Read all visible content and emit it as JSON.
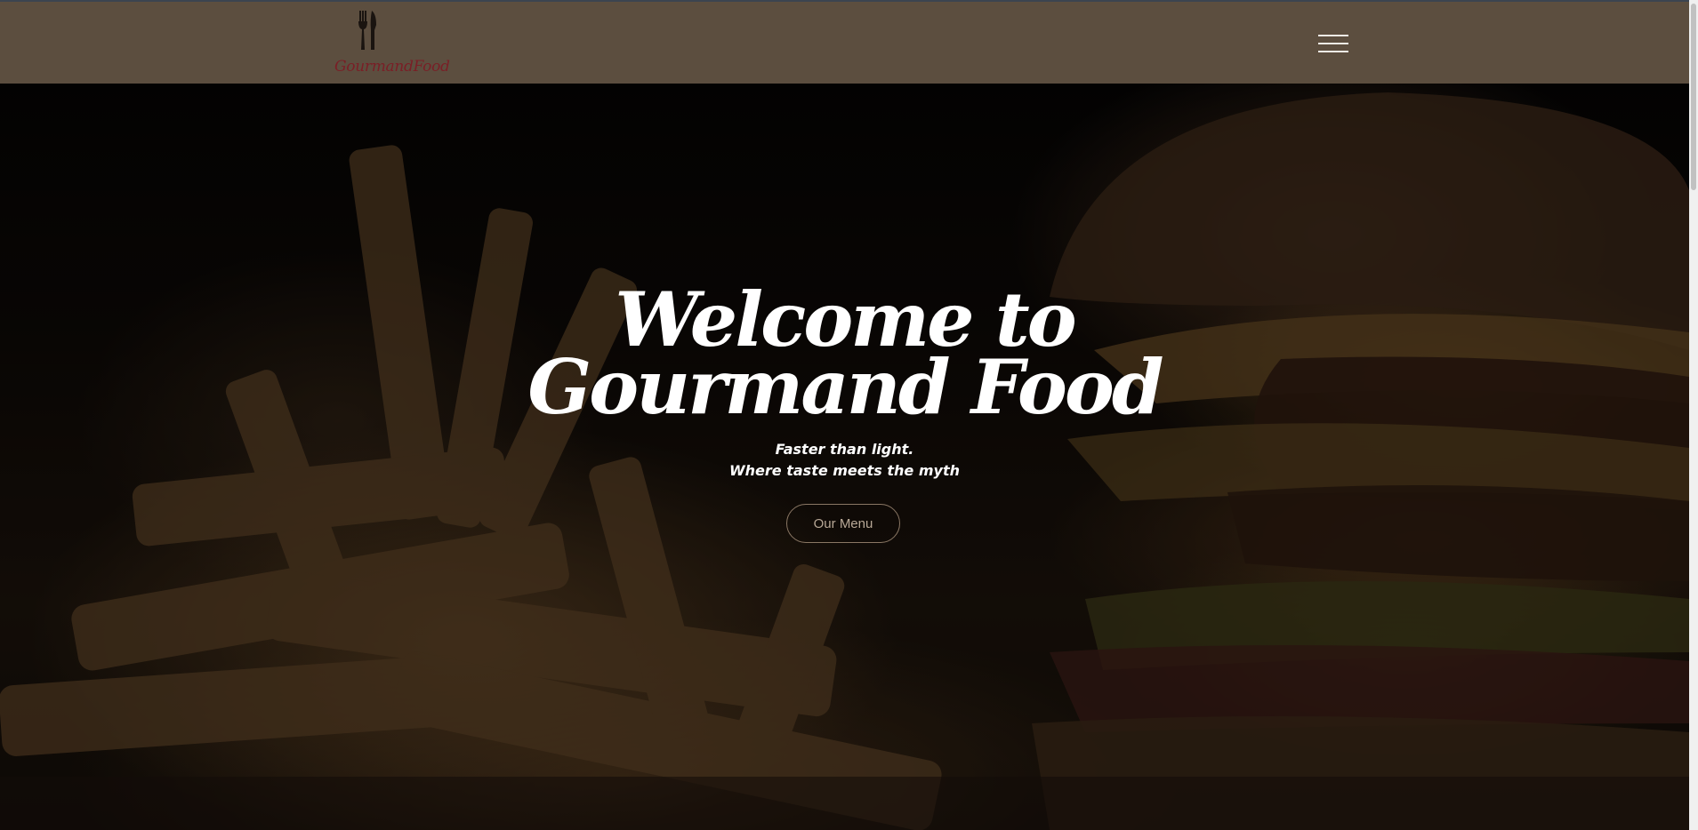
{
  "navbar": {
    "logo_text": "GourmandFood",
    "logo_icon": "fork-knife-icon",
    "menu_icon": "hamburger-menu-icon"
  },
  "hero": {
    "title_line1": "Welcome to",
    "title_line2": "Gourmand Food",
    "subtitle_line1": "Faster than light.",
    "subtitle_line2": "Where taste meets the myth",
    "cta_label": "Our Menu",
    "background": "burger-and-fries-photo"
  },
  "colors": {
    "navbar_bg": "#5c4e3f",
    "logo_text": "#7a1e26",
    "title_text": "#ffffff",
    "cta_border": "#8a7764",
    "cta_text": "#b8a896"
  }
}
